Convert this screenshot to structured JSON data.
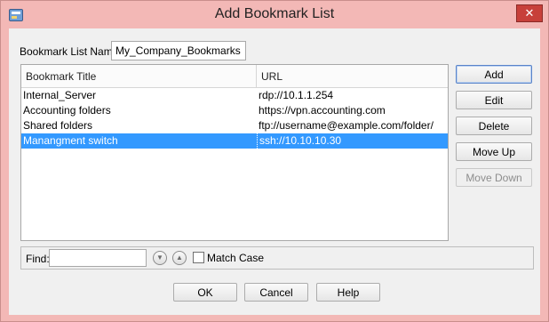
{
  "window": {
    "title": "Add Bookmark List",
    "close_glyph": "✕",
    "icon": "bookmark-list-app-icon"
  },
  "form": {
    "list_name_label": "Bookmark List Name:",
    "list_name_value": "My_Company_Bookmarks"
  },
  "table": {
    "columns": [
      "Bookmark Title",
      "URL"
    ],
    "rows": [
      {
        "title": "Internal_Server",
        "url": "rdp://10.1.1.254",
        "selected": false
      },
      {
        "title": "Accounting folders",
        "url": "https://vpn.accounting.com",
        "selected": false
      },
      {
        "title": "Shared folders",
        "url": "ftp://username@example.com/folder/",
        "selected": false
      },
      {
        "title": "Manangment switch",
        "url": "ssh://10.10.10.30",
        "selected": true
      }
    ]
  },
  "side_buttons": {
    "add": "Add",
    "edit": "Edit",
    "delete": "Delete",
    "move_up": "Move Up",
    "move_down": "Move Down"
  },
  "find": {
    "label": "Find:",
    "value": "",
    "match_case_label": "Match Case",
    "match_case_checked": false,
    "down_glyph": "▼",
    "up_glyph": "▲"
  },
  "footer": {
    "ok": "OK",
    "cancel": "Cancel",
    "help": "Help"
  }
}
